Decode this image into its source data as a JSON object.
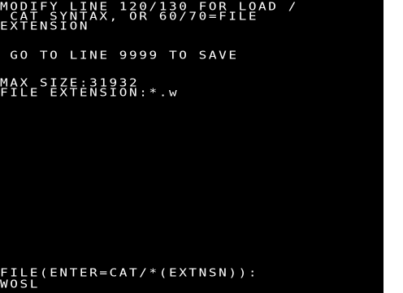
{
  "screen": {
    "background": "#000000",
    "foreground": "#ffffff",
    "lines": [
      "MODIFY LINE 120/130 FOR LOAD /",
      " CAT SYNTAX, OR 60/70=FILE",
      "EXTENSION",
      " GO TO LINE 9999 TO SAVE",
      "MAX SIZE:31932",
      "FILE EXTENSION:*.w",
      "FILE(ENTER=CAT/*(EXTNSN)):",
      "WOSL"
    ]
  }
}
